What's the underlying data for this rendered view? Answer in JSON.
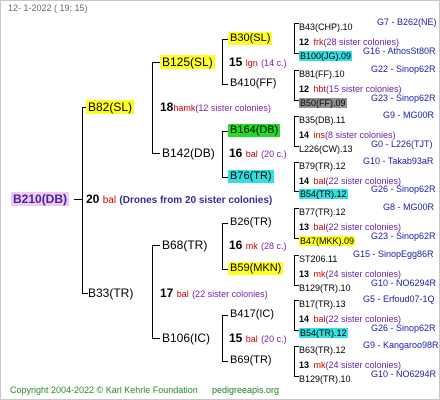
{
  "header": "12-  1-2022 ( 19: 15)",
  "footer": {
    "copyright": "Copyright 2004-2022 © Karl Kehrle Foundation",
    "site": "pedigreeapis.org"
  },
  "root": {
    "name": "B210(DB)",
    "gen_num": "20",
    "gen_name": "bal",
    "note": "(Drones from 20 sister colonies)"
  },
  "gen1": {
    "top": {
      "name": "B82(SL)",
      "num": "18",
      "nm": "hamk",
      "sis": "(12 sister colonies)"
    },
    "bottom": {
      "name": "B33(TR)",
      "num": "17",
      "nm": "bal",
      "sis": "(22 sister colonies)"
    }
  },
  "gen2": {
    "a": {
      "name": "B125(SL)",
      "num": "15",
      "nm": "lgn",
      "sis": "(14 c.)"
    },
    "b": {
      "name": "B142(DB)",
      "num": "16",
      "nm": "bal",
      "sis": "(20 c.)"
    },
    "c": {
      "name": "B68(TR)",
      "num": "16",
      "nm": "mk",
      "sis": "(28 c.)"
    },
    "d": {
      "name": "B106(IC)",
      "num": "15",
      "nm": "bal",
      "sis": "(20 c.)"
    }
  },
  "gen3": {
    "a1": {
      "name": "B30(SL)"
    },
    "a2": {
      "name": "B410(FF)"
    },
    "b1": {
      "name": "B164(DB)",
      "num": "14",
      "nm": "ins",
      "sis": "(8 sister colonies)"
    },
    "b2": {
      "name": "B76(TR)",
      "num": "14",
      "nm": "bal",
      "sis": "(22 sister colonies)"
    },
    "c1": {
      "name": "B26(TR)"
    },
    "c2": {
      "name": "B59(MKN)"
    },
    "d1": {
      "name": "B417(IC)",
      "num": "14",
      "nm": "bal",
      "sis": "(22 sister colonies)"
    },
    "d2": {
      "name": "B69(TR)"
    }
  },
  "leaves": [
    {
      "name": "B43(CHP).10",
      "code": "G7 - B262(NE)"
    },
    {
      "num": "12",
      "nm": "frk",
      "sis": "(28 sister colonies)"
    },
    {
      "name": "B100(JG).09",
      "code": "G16 - AthosSt80R"
    },
    {
      "name": "B81(FF).10",
      "code": "G22 - Sinop62R"
    },
    {
      "num": "12",
      "nm": "hbt",
      "sis": "(15 sister colonies)"
    },
    {
      "name": "B50(FF).09",
      "code": "G23 - Sinop62R"
    },
    {
      "name": "B35(DB).11",
      "code": "G9 - MG00R"
    },
    {
      "name": "L226(CW).13",
      "code": "G0 - L226(TJT)"
    },
    {
      "name": "B79(TR).12",
      "code": "G10 - Takab93aR"
    },
    {
      "name": "B54(TR).12",
      "code": "G26 - Sinop62R"
    },
    {
      "name": "B77(TR).12",
      "code": "G8 - MG00R"
    },
    {
      "num": "13",
      "nm": "bal",
      "sis": "(22 sister colonies)"
    },
    {
      "name": "B47(MKK).09",
      "code": "G23 - Sinop62R"
    },
    {
      "name": "ST206.11",
      "code": "G15 - SinopEgg86R"
    },
    {
      "num": "13",
      "nm": "mk",
      "sis": "(24 sister colonies)"
    },
    {
      "name": "B129(TR).10",
      "code": "G10 - NO6294R"
    },
    {
      "name": "B17(TR).13",
      "code": "G5 - Erfoud07-1Q"
    },
    {
      "name": "B54(TR).12",
      "code": "G26 - Sinop62R"
    },
    {
      "name": "B63(TR).12",
      "code": "G9 - Kangaroo98R"
    },
    {
      "num": "13",
      "nm": "mk",
      "sis": "(24 sister colonies)"
    },
    {
      "name": "B129(TR).10",
      "code": "G10 - NO6294R"
    }
  ]
}
